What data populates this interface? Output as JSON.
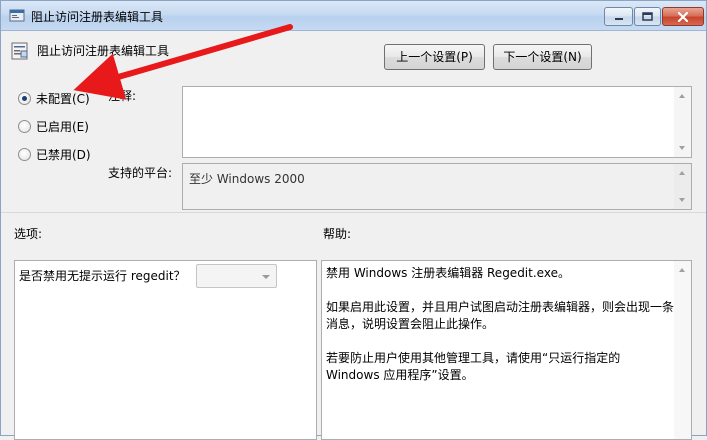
{
  "window": {
    "title": "阻止访问注册表编辑工具"
  },
  "header": {
    "policy_name": "阻止访问注册表编辑工具"
  },
  "nav": {
    "prev_label": "上一个设置(P)",
    "next_label": "下一个设置(N)"
  },
  "state": {
    "options": [
      {
        "label": "未配置(C)",
        "checked": true
      },
      {
        "label": "已启用(E)",
        "checked": false
      },
      {
        "label": "已禁用(D)",
        "checked": false
      }
    ]
  },
  "comment": {
    "label": "注释:",
    "value": ""
  },
  "platform": {
    "label": "支持的平台:",
    "value": "至少 Windows 2000"
  },
  "options_panel": {
    "label": "选项:",
    "question": "是否禁用无提示运行 regedit？",
    "selected": ""
  },
  "help_panel": {
    "label": "帮助:",
    "paragraphs": [
      "禁用 Windows 注册表编辑器 Regedit.exe。",
      "如果启用此设置，并且用户试图启动注册表编辑器，则会出现一条\n消息，说明设置会阻止此操作。",
      "若要防止用户使用其他管理工具，请使用“只运行指定的\nWindows 应用程序”设置。"
    ]
  },
  "annotation": {
    "arrow_color": "#e8191a"
  }
}
